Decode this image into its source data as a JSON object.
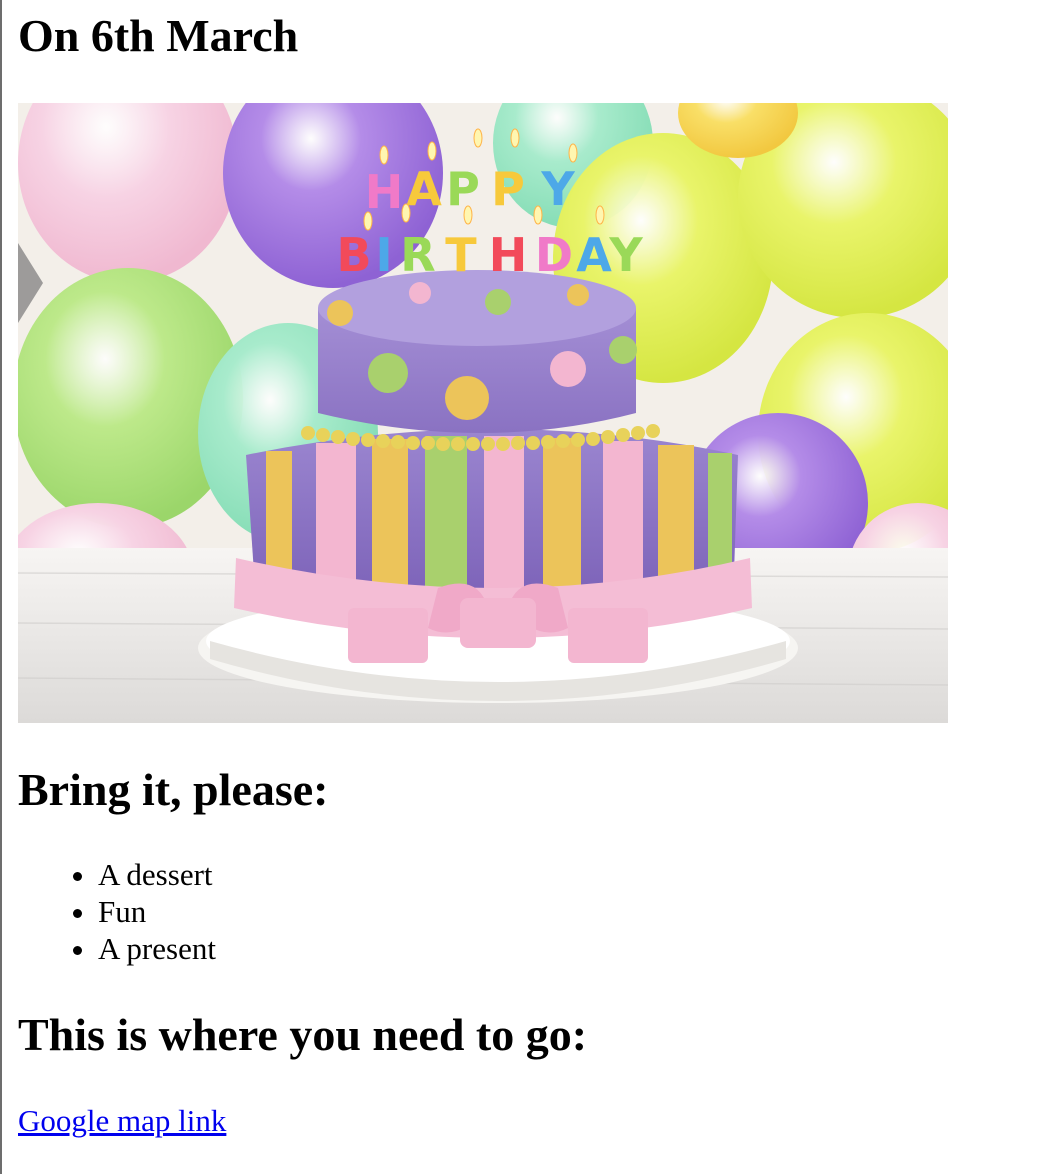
{
  "invite": {
    "date_heading": "On 6th March",
    "photo_caption_letters": [
      "H",
      "A",
      "P",
      "P",
      "Y",
      "B",
      "I",
      "R",
      "T",
      "H",
      "D",
      "A",
      "Y"
    ],
    "bring_heading": "Bring it, please:",
    "items": [
      "A dessert",
      "Fun",
      "A present"
    ],
    "where_heading": "This is where you need to go:",
    "map_link_text": "Google map link"
  },
  "colors": {
    "link": "#0000ee",
    "cake_purple": "#9a86cc",
    "cake_pink": "#f3b6d0",
    "cake_yellow": "#ecc45a",
    "cake_green": "#a9d06d"
  },
  "icons": {
    "bullet": "disc"
  }
}
